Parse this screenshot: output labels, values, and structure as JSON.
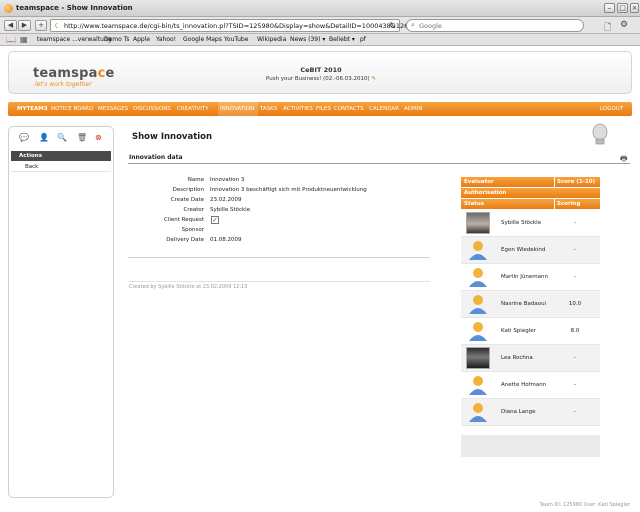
{
  "window": {
    "title": "teamspace - Show Innovation"
  },
  "browser": {
    "url": "http://www.teamspace.de/cgi-bin/ts_innovation.pl?TSID=125980&Display=show&DetailID=1000438&1266498594",
    "search_placeholder": "Google",
    "bookmarks": [
      "teamspace ...verwaltung",
      "Demo Ts",
      "Apple",
      "Yahoo!",
      "Google Maps",
      "YouTube",
      "Wikipedia",
      "News (39) ▾",
      "Beliebt ▾",
      "pf"
    ]
  },
  "banner": {
    "logo_left": "teamspa",
    "logo_accent": "c",
    "logo_right": "e",
    "tagline": "let's work together",
    "event_title": "CeBIT 2010",
    "event_sub": "Push your Business! (02.-06.03.2010)"
  },
  "menu": {
    "items": [
      "MYTEAM3",
      "NOTICE BOARD",
      "MESSAGES",
      "DISCUSSIONS",
      "CREATIVITY",
      "INNOVATION",
      "TASKS",
      "ACTIVITIES",
      "FILES",
      "CONTACTS",
      "CALENDAR",
      "ADMIN"
    ],
    "logout": "LOGOUT"
  },
  "sidebar": {
    "heading": "Actions",
    "back": "Back"
  },
  "main": {
    "title": "Show Innovation",
    "section": "Innovation data",
    "fields": [
      {
        "label": "Name",
        "value": "Innovation 3"
      },
      {
        "label": "Description",
        "value": "Innovation 3 beschäftigt sich mit Produktneuentwicklung"
      },
      {
        "label": "Create Date",
        "value": "23.02.2009"
      },
      {
        "label": "Creator",
        "value": "Sybille Stöckle"
      },
      {
        "label": "Client Request",
        "value": ""
      },
      {
        "label": "Sponsor",
        "value": ""
      },
      {
        "label": "Delivery Date",
        "value": "01.08.2009"
      }
    ],
    "client_request_checked": true,
    "created_by": "Created by Sybille Stöckle at 23.02.2009 12:15"
  },
  "evaluators": {
    "header1_left": "Evaluator",
    "header1_right": "Score (1-10)",
    "header2": "Authorisation",
    "header3_left": "Status",
    "header3_right": "Scoring",
    "rows": [
      {
        "name": "Sybille Stöckle",
        "score": "-"
      },
      {
        "name": "Egon Wiedekind",
        "score": "-"
      },
      {
        "name": "Martin Jünemann",
        "score": "-"
      },
      {
        "name": "Nasrine Badaoui",
        "score": "10.0"
      },
      {
        "name": "Kati Spiegler",
        "score": "8.0"
      },
      {
        "name": "Lea Rochna",
        "score": "-"
      },
      {
        "name": "Anette Hofmann",
        "score": "-"
      },
      {
        "name": "Diana Lange",
        "score": "-"
      }
    ]
  },
  "footer": {
    "status": "Team ID: 125980  User: Kati Spiegler"
  },
  "colors": {
    "accent": "#f08a1c",
    "menu_top": "#f7a33f",
    "menu_bottom": "#e9780e"
  }
}
